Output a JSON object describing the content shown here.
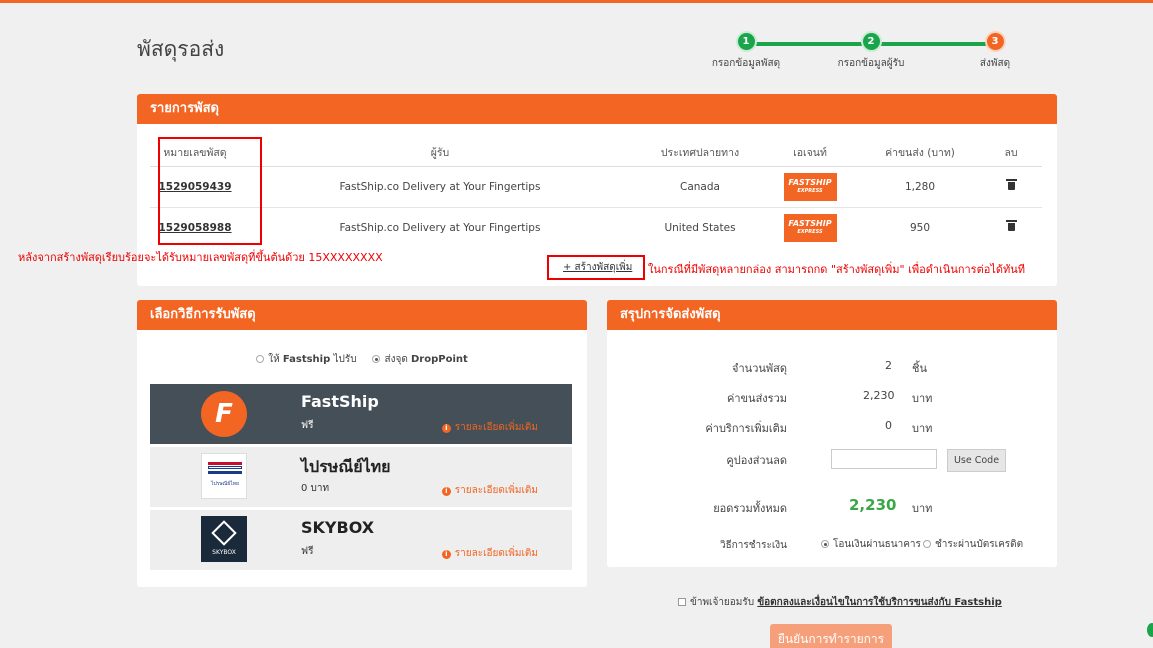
{
  "page": {
    "title": "พัสดุรอส่ง"
  },
  "steps": [
    {
      "num": "1",
      "label": "กรอกข้อมูลพัสดุ",
      "color": "#1aa54b"
    },
    {
      "num": "2",
      "label": "กรอกข้อมูลผู้รับ",
      "color": "#1aa54b"
    },
    {
      "num": "3",
      "label": "ส่งพัสดุ",
      "color": "#f26522"
    }
  ],
  "parcels": {
    "heading": "รายการพัสดุ",
    "columns": [
      "หมายเลขพัสดุ",
      "ผู้รับ",
      "ประเทศปลายทาง",
      "เอเจนท์",
      "ค่าขนส่ง (บาท)",
      "ลบ"
    ],
    "rows": [
      {
        "tracking": "1529059439",
        "recipient": "FastShip.co Delivery at Your Fingertips",
        "country": "Canada",
        "agent_logo": "FASTSHIP",
        "agent_sub": "EXPRESS",
        "fee": "1,280",
        "delete_icon": "trash-icon"
      },
      {
        "tracking": "1529058988",
        "recipient": "FastShip.co Delivery at Your Fingertips",
        "country": "United States",
        "agent_logo": "FASTSHIP",
        "agent_sub": "EXPRESS",
        "fee": "950",
        "delete_icon": "trash-icon"
      }
    ],
    "add_parcel": "+ สร้างพัสดุเพิ่ม"
  },
  "annotations": {
    "tracking_note": "หลังจากสร้างพัสดุเรียบร้อยจะได้รับหมายเลขพัสดุที่ขึ้นต้นด้วย 15XXXXXXXX",
    "add_note": "ในกรณีที่มีพัสดุหลายกล่อง สามารถกด \"สร้างพัสดุเพิ่ม\" เพื่อดำเนินการต่อได้ทันที"
  },
  "pickup": {
    "heading": "เลือกวิธีการรับพัสดุ",
    "option_pickup_prefix": "ให้",
    "option_pickup_brand": "Fastship",
    "option_pickup_suffix": "ไปรับ",
    "option_drop_prefix": "ส่งจุด",
    "option_drop_brand": "DropPoint",
    "carriers": [
      {
        "name": "FastShip",
        "price": "ฟรี",
        "more": "รายละเอียดเพิ่มเติม",
        "logo_letter": "F"
      },
      {
        "name": "ไปรษณีย์ไทย",
        "price": "0 บาท",
        "more": "รายละเอียดเพิ่มเติม",
        "logo_text": "ไปรษณีย์ไทย"
      },
      {
        "name": "SKYBOX",
        "price": "ฟรี",
        "more": "รายละเอียดเพิ่มเติม",
        "logo_text": "SKYBOX"
      }
    ]
  },
  "summary": {
    "heading": "สรุปการจัดส่งพัสดุ",
    "count_label": "จำนวนพัสดุ",
    "count_value": "2",
    "count_unit": "ชิ้น",
    "shipping_label": "ค่าขนส่งรวม",
    "shipping_value": "2,230",
    "shipping_unit": "บาท",
    "service_label": "ค่าบริการเพิ่มเติม",
    "service_value": "0",
    "service_unit": "บาท",
    "coupon_label": "คูปองส่วนลด",
    "coupon_value": "",
    "use_code": "Use Code",
    "total_label": "ยอดรวมทั้งหมด",
    "total_value": "2,230",
    "total_unit": "บาท",
    "payment_label": "วิธีการชำระเงิน",
    "payment_transfer": "โอนเงินผ่านธนาคาร",
    "payment_card": "ชำระผ่านบัตรเครดิต"
  },
  "footer": {
    "agree_text": "ข้าพเจ้ายอมรับ",
    "agree_link": "ข้อตกลงและเงื่อนไขในการใช้บริการขนส่งกับ",
    "agree_brand": "Fastship",
    "confirm": "ยืนยันการทำรายการ"
  }
}
